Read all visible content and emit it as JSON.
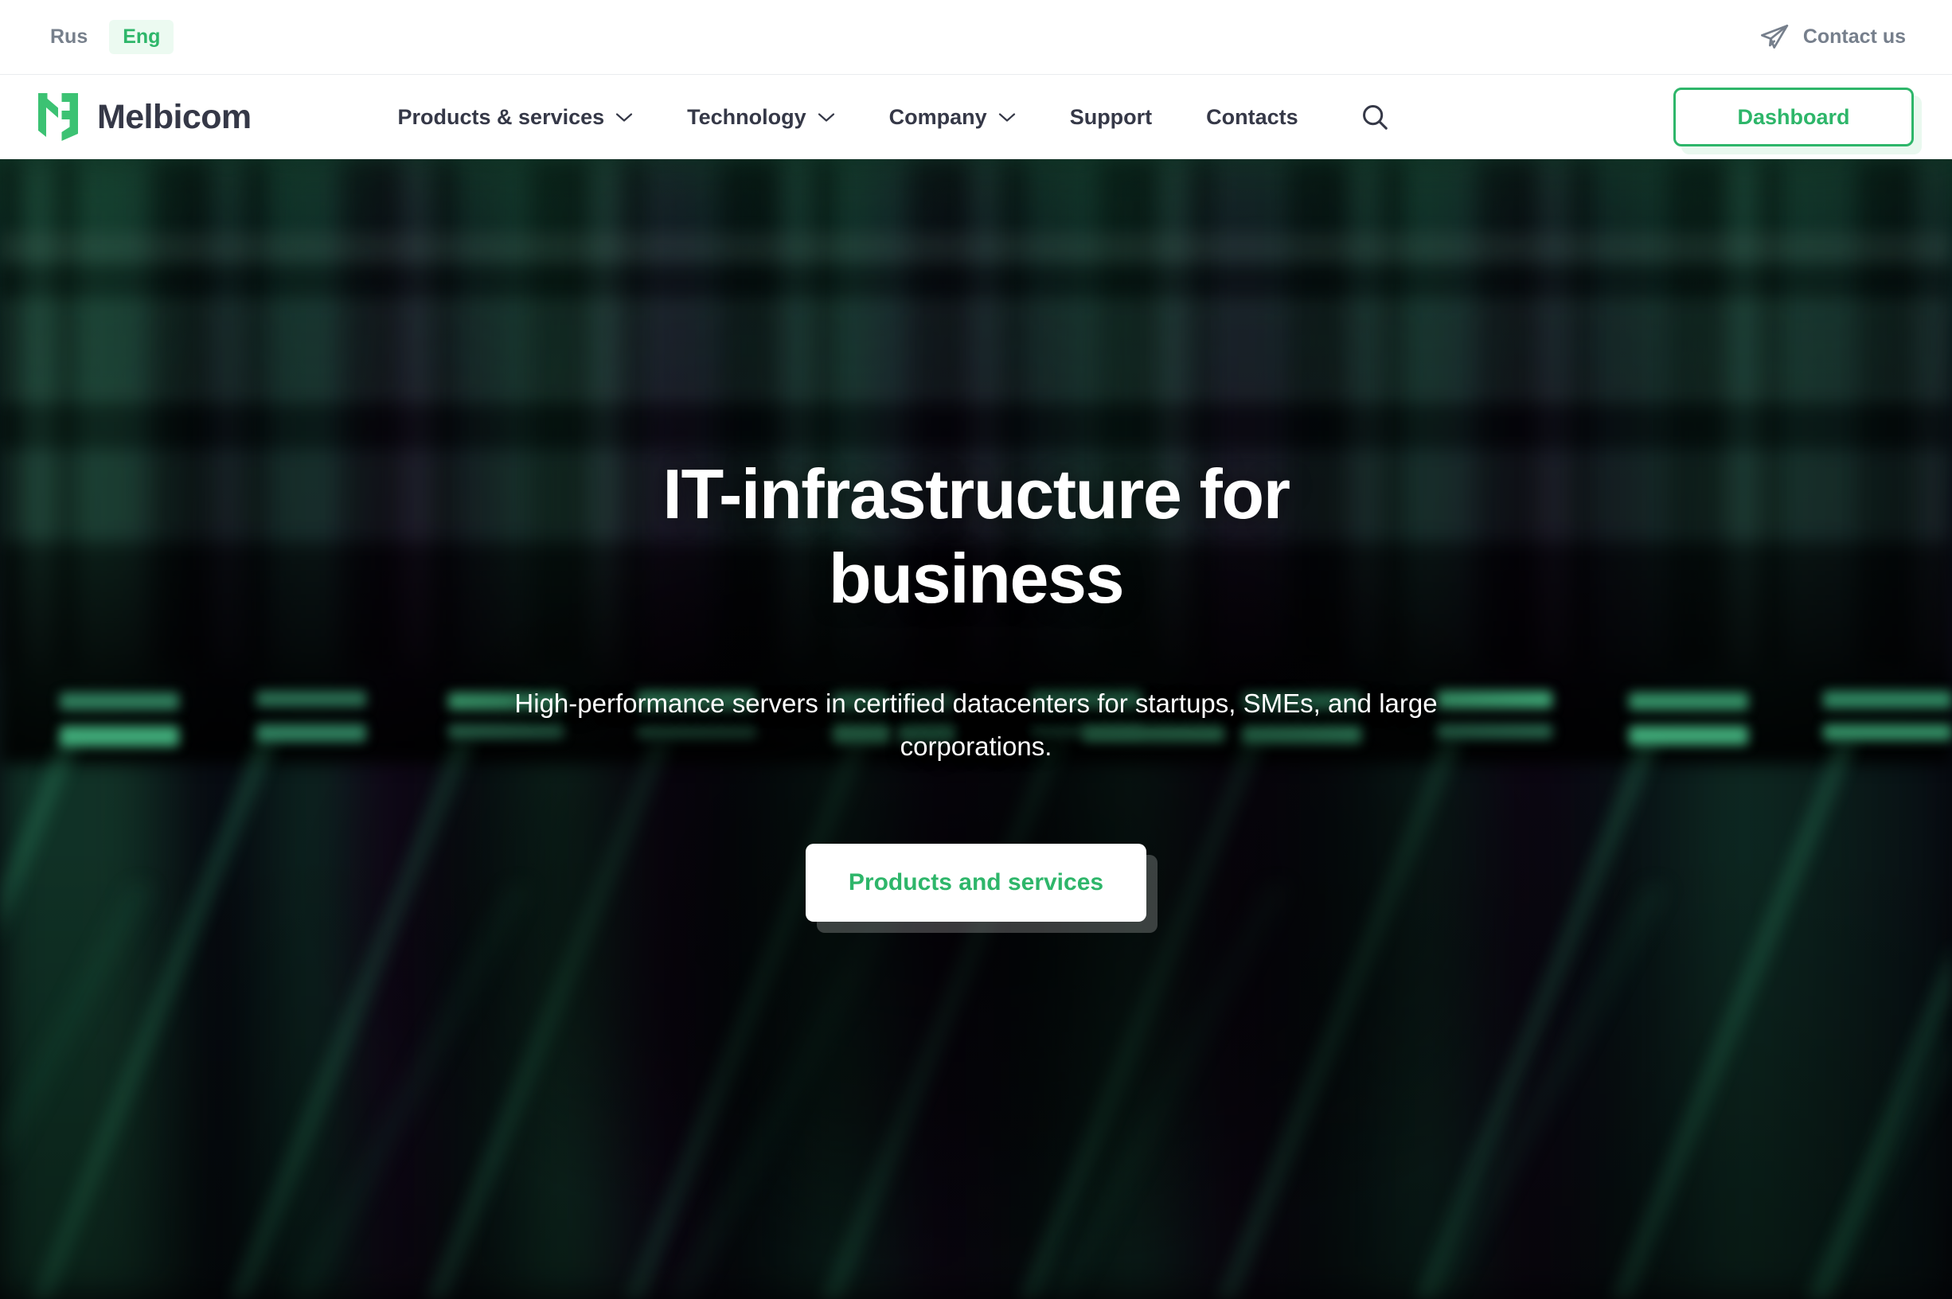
{
  "topbar": {
    "languages": [
      {
        "code": "rus",
        "label": "Rus",
        "active": false
      },
      {
        "code": "eng",
        "label": "Eng",
        "active": true
      }
    ],
    "contact": {
      "label": "Contact us",
      "icon": "paper-plane-icon"
    }
  },
  "nav": {
    "brand": {
      "name": "Melbicom",
      "mark": "melbicom-logo-mark"
    },
    "items": [
      {
        "label": "Products & services",
        "has_dropdown": true
      },
      {
        "label": "Technology",
        "has_dropdown": true
      },
      {
        "label": "Company",
        "has_dropdown": true
      },
      {
        "label": "Support",
        "has_dropdown": false
      },
      {
        "label": "Contacts",
        "has_dropdown": false
      }
    ],
    "search_icon": "search-icon",
    "dashboard_label": "Dashboard"
  },
  "hero": {
    "title": "IT-infrastructure for business",
    "subtitle": "High-performance servers in certified datacenters for startups, SMEs, and large corporations.",
    "cta_label": "Products and services",
    "background": "blurred-datacenter-server-racks"
  },
  "colors": {
    "brand_green": "#2eb66a",
    "logo_green": "#3cc273",
    "dark_text": "#353847",
    "muted_text": "#77808c",
    "lang_pill_bg": "#ecfaf1",
    "hero_dark": "#05040a",
    "border": "#e9ecef"
  }
}
